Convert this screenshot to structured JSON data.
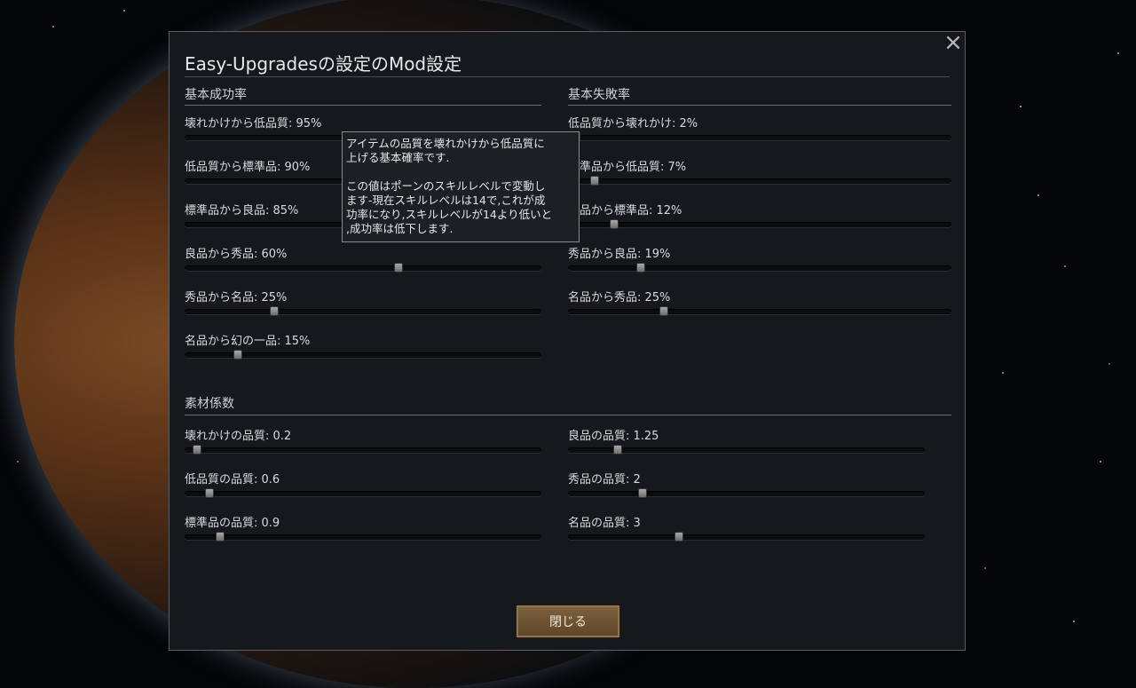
{
  "dialog": {
    "title": "Easy-Upgradesの設定のMod設定",
    "close_icon": "×",
    "close_button_label": "閉じる"
  },
  "success": {
    "heading": "基本成功率",
    "items": [
      {
        "label": "壊れかけから低品質: 95%",
        "value": 95,
        "max": 100
      },
      {
        "label": "低品質から標準品: 90%",
        "value": 90,
        "max": 100
      },
      {
        "label": "標準品から良品: 85%",
        "value": 85,
        "max": 100
      },
      {
        "label": "良品から秀品: 60%",
        "value": 60,
        "max": 100
      },
      {
        "label": "秀品から名品: 25%",
        "value": 25,
        "max": 100
      },
      {
        "label": "名品から幻の一品: 15%",
        "value": 15,
        "max": 100
      }
    ]
  },
  "failure": {
    "heading": "基本失敗率",
    "items": [
      {
        "label": "低品質から壊れかけ: 2%",
        "value": 2,
        "max": 100
      },
      {
        "label": "標準品から低品質: 7%",
        "value": 7,
        "max": 100
      },
      {
        "label": "良品から標準品: 12%",
        "value": 12,
        "max": 100
      },
      {
        "label": "秀品から良品: 19%",
        "value": 19,
        "max": 100
      },
      {
        "label": "名品から秀品: 25%",
        "value": 25,
        "max": 100
      }
    ]
  },
  "material": {
    "heading": "素材係数",
    "left": [
      {
        "label": "壊れかけの品質: 0.2",
        "fraction": 0.035
      },
      {
        "label": "低品質の品質: 0.6",
        "fraction": 0.07
      },
      {
        "label": "標準品の品質: 0.9",
        "fraction": 0.1
      }
    ],
    "right": [
      {
        "label": "良品の品質: 1.25",
        "fraction": 0.14
      },
      {
        "label": "秀品の品質: 2",
        "fraction": 0.21
      },
      {
        "label": "名品の品質: 3",
        "fraction": 0.31
      }
    ]
  },
  "tooltip": {
    "text": "アイテムの品質を壊れかけから低品質に\n上げる基本確率です.\n\nこの値はポーンのスキルレベルで変動し\nます-現在スキルレベルは14で,これが成\n功率になり,スキルレベルが14より低いと\n,成功率は低下します."
  }
}
